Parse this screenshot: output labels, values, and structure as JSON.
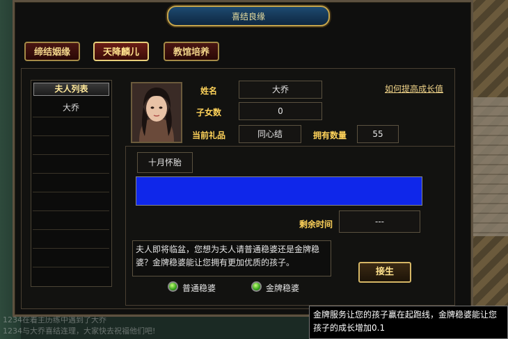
{
  "window": {
    "title": "喜结良缘"
  },
  "tabs": [
    {
      "label": "缔结姻缘",
      "active": false
    },
    {
      "label": "天降麟儿",
      "active": true
    },
    {
      "label": "教馆培养",
      "active": false
    }
  ],
  "wives_list": {
    "header": "夫人列表",
    "items": [
      "大乔"
    ]
  },
  "info": {
    "name_label": "姓名",
    "name_value": "大乔",
    "children_label": "子女数",
    "children_value": "0",
    "gift_label": "当前礼品",
    "gift_value": "同心结",
    "owned_label": "拥有数量",
    "owned_value": "55",
    "growth_link": "如何提高成长值"
  },
  "pregnancy": {
    "stage": "十月怀胎",
    "progress": 1.0,
    "progress_color": "#0f27ea",
    "remaining_label": "剩余时间",
    "remaining_value": "---"
  },
  "message": "夫人即将临盆，您想为夫人请普通稳婆还是金牌稳婆？金牌稳婆能让您拥有更加优质的孩子。",
  "options": [
    "普通稳婆",
    "金牌稳婆"
  ],
  "deliver_button": "接生",
  "tooltip": "金牌服务让您的孩子赢在起跑线，金牌稳婆能让您孩子的成长增加0.1",
  "background_chat": [
    "1234在着主历练中遇到了大乔",
    "1234与大乔喜结连理，大家快去祝福他们吧!"
  ]
}
